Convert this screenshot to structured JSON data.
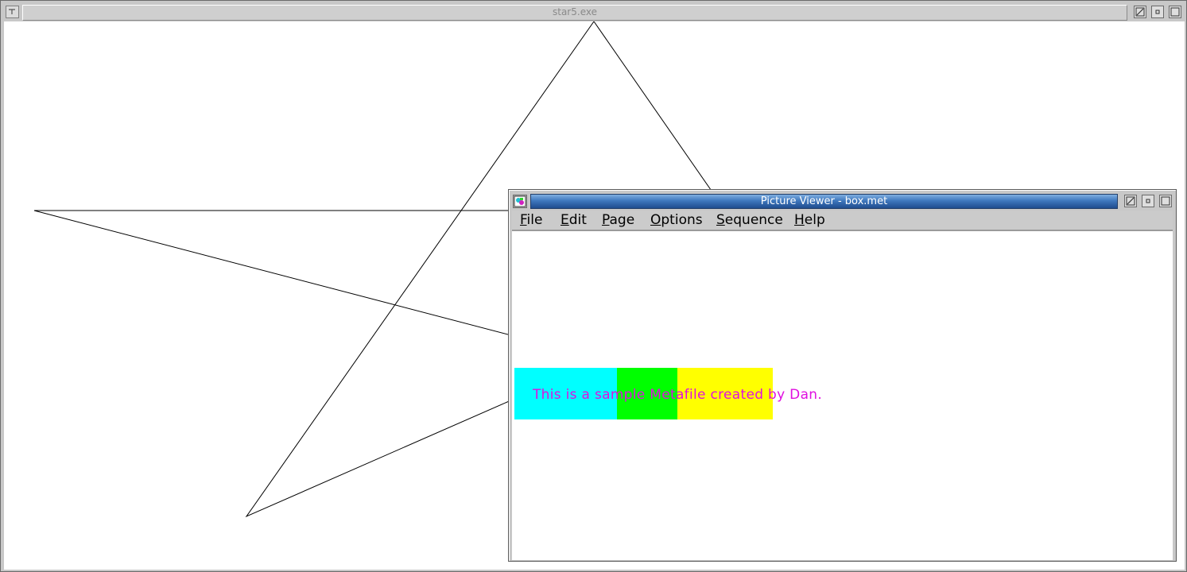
{
  "star_window": {
    "title": "star5.exe"
  },
  "picture_viewer": {
    "title": "Picture Viewer - box.met",
    "menu": [
      {
        "accel": "F",
        "rest": "ile"
      },
      {
        "accel": "E",
        "rest": "dit"
      },
      {
        "accel": "P",
        "rest": "age"
      },
      {
        "accel": "O",
        "rest": "ptions"
      },
      {
        "accel": "S",
        "rest": "equence"
      },
      {
        "accel": "H",
        "rest": "elp"
      }
    ],
    "metafile": {
      "text": "This is a sample Metafile created by Dan.",
      "text_color": "#e010e0",
      "box_colors": {
        "cyan": "#00ffff",
        "green": "#00ff00",
        "yellow": "#ffff00"
      }
    }
  }
}
